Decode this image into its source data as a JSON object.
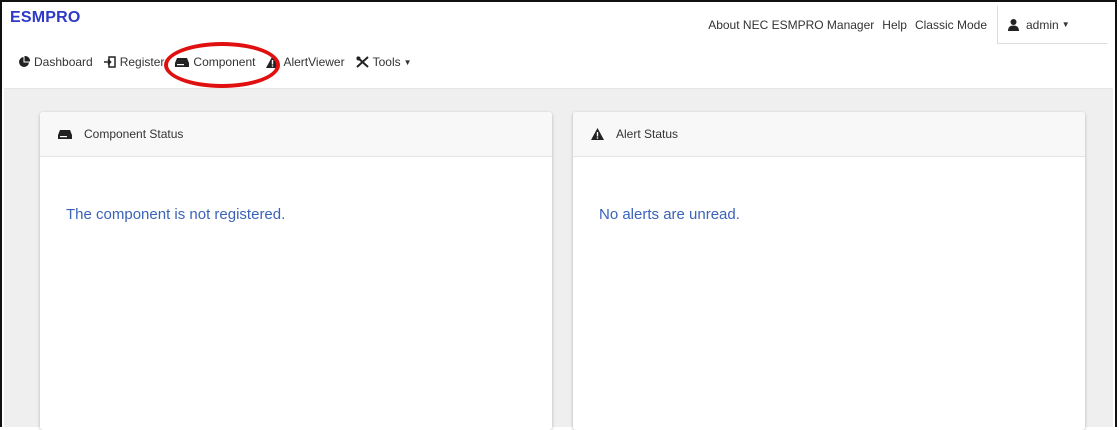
{
  "brand": "ESMPRO",
  "header_links": {
    "about": "About NEC ESMPRO Manager",
    "help": "Help",
    "classic": "Classic Mode",
    "user": "admin"
  },
  "nav": [
    {
      "label": "Dashboard",
      "icon": "pie-chart-icon"
    },
    {
      "label": "Register",
      "icon": "register-icon"
    },
    {
      "label": "Component",
      "icon": "server-icon"
    },
    {
      "label": "AlertViewer",
      "icon": "warning-icon"
    },
    {
      "label": "Tools",
      "icon": "tools-icon"
    }
  ],
  "cards": {
    "component": {
      "title": "Component Status",
      "message": "The component is not registered."
    },
    "alert": {
      "title": "Alert Status",
      "message": "No alerts are unread."
    }
  },
  "colors": {
    "brand": "#2c39c9",
    "message": "#3b63b8",
    "highlight": "#e01010",
    "content_bg": "#efefef"
  }
}
